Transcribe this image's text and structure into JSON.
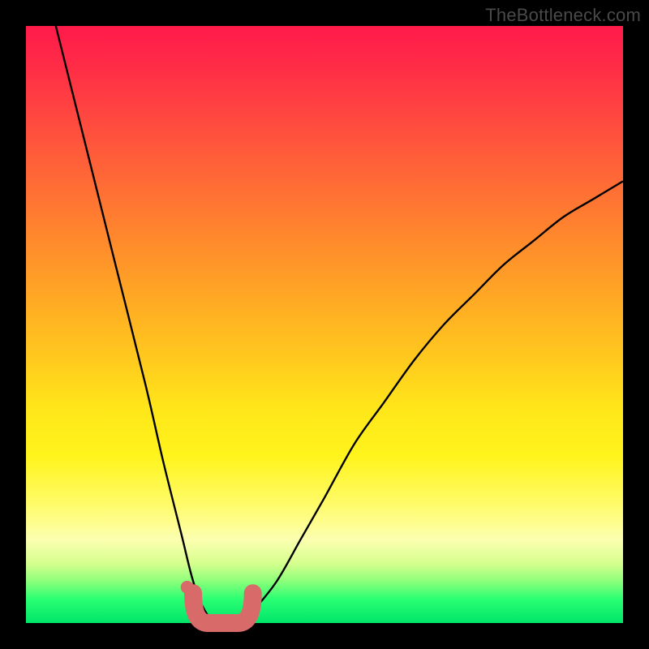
{
  "watermark": "TheBottleneck.com",
  "chart_data": {
    "type": "line",
    "title": "",
    "xlabel": "",
    "ylabel": "",
    "xlim": [
      0,
      100
    ],
    "ylim": [
      0,
      100
    ],
    "grid": false,
    "series": [
      {
        "name": "bottleneck-curve",
        "x": [
          5,
          10,
          15,
          20,
          23,
          26,
          28,
          30,
          32,
          34,
          36,
          38,
          42,
          46,
          50,
          55,
          60,
          65,
          70,
          75,
          80,
          85,
          90,
          95,
          100
        ],
        "values": [
          100,
          80,
          60,
          40,
          27,
          15,
          7,
          2,
          0,
          0,
          0,
          2,
          7,
          14,
          21,
          30,
          37,
          44,
          50,
          55,
          60,
          64,
          68,
          71,
          74
        ]
      }
    ],
    "valley": {
      "x_start": 28,
      "x_end": 38,
      "height_pct": 5
    },
    "dot": {
      "x": 27,
      "y": 6
    }
  },
  "colors": {
    "curve": "#000000",
    "valley_fill": "#d96a6a",
    "dot": "#d96a6a",
    "background_top": "#ff1a4a",
    "background_bottom": "#00e56a"
  }
}
